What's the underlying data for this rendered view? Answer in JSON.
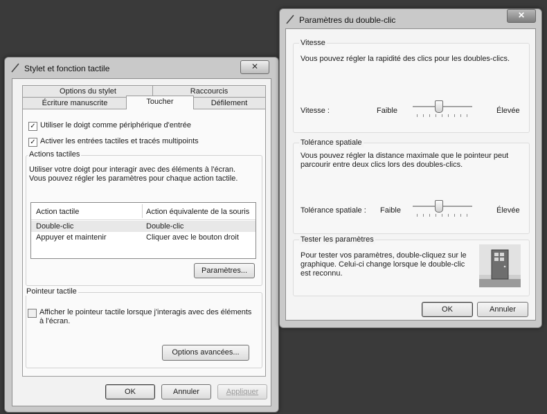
{
  "win1": {
    "title": "Stylet et fonction tactile",
    "tabs_top": [
      "Options du stylet",
      "Raccourcis"
    ],
    "tabs_bottom": [
      "Écriture manuscrite",
      "Toucher",
      "Défilement"
    ],
    "chk_finger": "Utiliser le doigt comme périphérique d'entrée",
    "chk_multitouch": "Activer les entrées tactiles et tracés multipoints",
    "actions_legend": "Actions tactiles",
    "actions_desc1": "Utiliser votre doigt pour interagir avec des éléments à l'écran.",
    "actions_desc2": "Vous pouvez régler les paramètres pour chaque action tactile.",
    "list": {
      "headers": [
        "Action tactile",
        "Action équivalente de la souris"
      ],
      "rows": [
        [
          "Double-clic",
          "Double-clic"
        ],
        [
          "Appuyer et maintenir",
          "Cliquer avec le bouton droit"
        ]
      ]
    },
    "settings_btn": "Paramètres...",
    "pointer_legend": "Pointeur tactile",
    "pointer_chk_l1": "Afficher le pointeur tactile lorsque j'interagis avec des éléments",
    "pointer_chk_l2": "à l'écran.",
    "advanced_btn": "Options avancées...",
    "ok": "OK",
    "cancel": "Annuler",
    "apply": "Appliquer"
  },
  "win2": {
    "title": "Paramètres du double-clic",
    "speed_legend": "Vitesse",
    "speed_desc": "Vous pouvez régler la rapidité des clics pour les doubles-clics.",
    "speed_label": "Vitesse :",
    "speed_low": "Faible",
    "speed_high": "Élevée",
    "tol_legend": "Tolérance spatiale",
    "tol_desc1": "Vous pouvez régler la distance maximale que le pointeur peut",
    "tol_desc2": "parcourir entre deux clics lors des doubles-clics.",
    "tol_label": "Tolérance spatiale :",
    "tol_low": "Faible",
    "tol_high": "Élevée",
    "test_legend": "Tester les paramètres",
    "test_desc1": "Pour tester vos paramètres, double-cliquez sur le",
    "test_desc2": "graphique. Celui-ci change lorsque le double-clic",
    "test_desc3": "est reconnu.",
    "ok": "OK",
    "cancel": "Annuler"
  }
}
